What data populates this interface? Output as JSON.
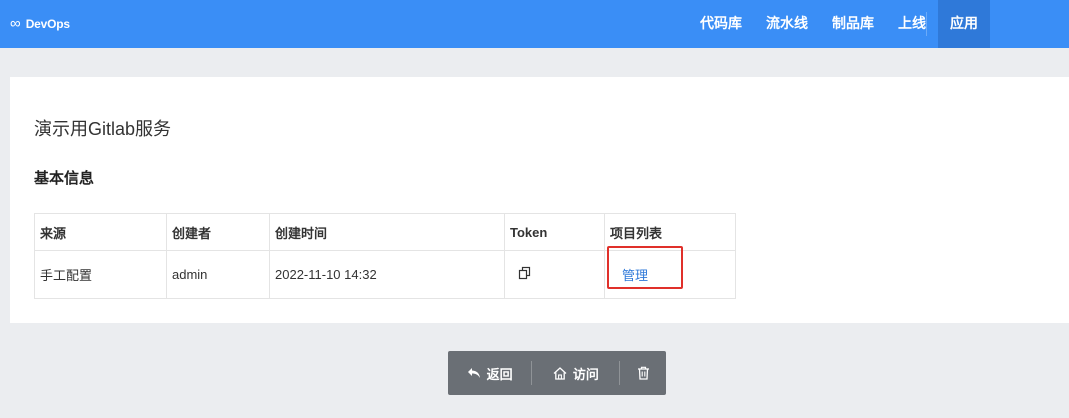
{
  "header": {
    "brand": "DevOps",
    "nav": [
      "代码库",
      "流水线",
      "制品库",
      "上线"
    ],
    "active": "应用"
  },
  "page": {
    "title": "演示用Gitlab服务",
    "section_title": "基本信息"
  },
  "table": {
    "headers": [
      "来源",
      "创建者",
      "创建时间",
      "Token",
      "项目列表"
    ],
    "row": {
      "source": "手工配置",
      "creator": "admin",
      "created_at": "2022-11-10 14:32",
      "project_link": "管理"
    }
  },
  "actions": {
    "back": "返回",
    "visit": "访问"
  },
  "colors": {
    "header_bg": "#3a8ef6",
    "active_tab": "#2f79d9",
    "link": "#2f79d9",
    "highlight": "#e0302a",
    "button_group": "#6a6f75"
  }
}
